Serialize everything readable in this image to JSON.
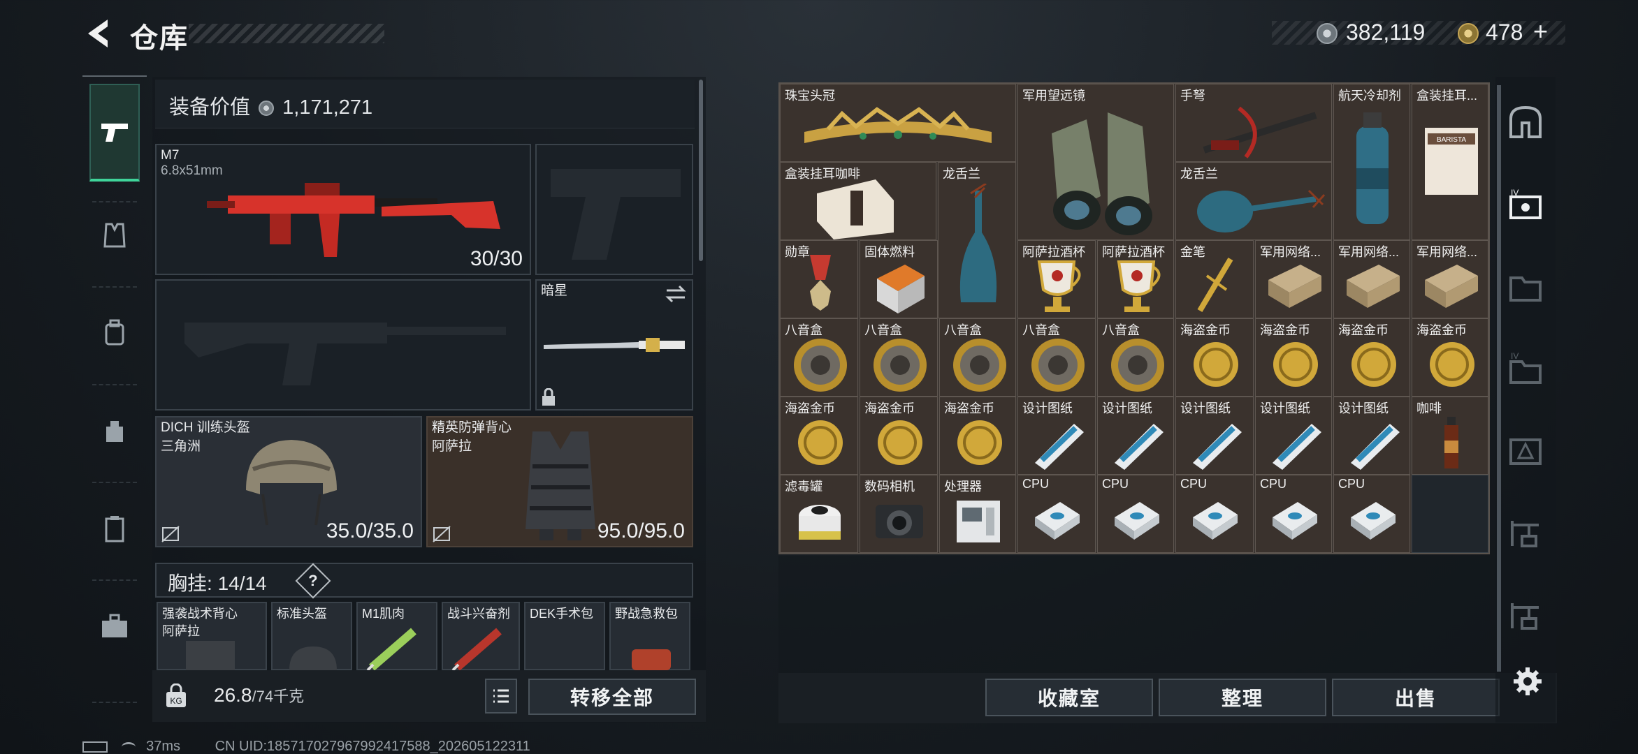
{
  "header": {
    "title": "仓库",
    "currency_silver": "382,119",
    "currency_gold": "478",
    "plus_label": "+"
  },
  "left_nav": {
    "items": [
      {
        "name": "weapons",
        "icon": "pistol-icon"
      },
      {
        "name": "armor",
        "icon": "vest-icon"
      },
      {
        "name": "backpack",
        "icon": "backpack-icon"
      },
      {
        "name": "bag",
        "icon": "bag-icon"
      },
      {
        "name": "clipboard",
        "icon": "clipboard-icon"
      },
      {
        "name": "toolbox",
        "icon": "toolbox-icon"
      }
    ]
  },
  "loadout": {
    "value_label": "装备价值",
    "value": "1,171,271",
    "primary": {
      "name": "M7",
      "ammo": "6.8x51mm",
      "count": "30/30"
    },
    "secondary_pistol": {
      "name": ""
    },
    "secondary_rifle": {
      "name": ""
    },
    "melee": {
      "name": "暗星"
    },
    "helmet": {
      "name": "DICH 训练头盔",
      "sub": "三角洲",
      "durability": "35.0/35.0"
    },
    "armor": {
      "name": "精英防弹背心",
      "sub": "阿萨拉",
      "durability": "95.0/95.0"
    },
    "chest_label": "胸挂:",
    "chest_count": "14/14",
    "chest_help": "?",
    "rig_items": [
      {
        "name": "强袭战术背心",
        "sub": "阿萨拉"
      },
      {
        "name": "标准头盔",
        "sub": ""
      },
      {
        "name": "M1肌肉",
        "sub": ""
      },
      {
        "name": "战斗兴奋剂",
        "sub": ""
      },
      {
        "name": "DEK手术包",
        "sub": ""
      },
      {
        "name": "野战急救包",
        "sub": ""
      }
    ],
    "weight": "26.8",
    "weight_max": "/74千克",
    "transfer_all": "转移全部"
  },
  "storage": {
    "items": [
      {
        "label": "珠宝头冠",
        "icon": "tiara-icon"
      },
      {
        "label": "军用望远镜",
        "icon": "binoculars-icon"
      },
      {
        "label": "手弩",
        "icon": "crossbow-icon"
      },
      {
        "label": "航天冷却剂",
        "icon": "coolant-icon"
      },
      {
        "label": "盒装挂耳...",
        "icon": "coffee-box-icon"
      },
      {
        "label": "盒装挂耳咖啡",
        "icon": "coffee-box-icon"
      },
      {
        "label": "龙舌兰",
        "icon": "bottle-icon"
      },
      {
        "label": "龙舌兰",
        "icon": "lamp-icon"
      },
      {
        "label": "勋章",
        "icon": "medal-icon"
      },
      {
        "label": "固体燃料",
        "icon": "fuel-icon"
      },
      {
        "label": "阿萨拉酒杯",
        "icon": "goblet-icon"
      },
      {
        "label": "阿萨拉酒杯",
        "icon": "goblet-icon"
      },
      {
        "label": "金笔",
        "icon": "pen-icon"
      },
      {
        "label": "军用网络...",
        "icon": "network-icon"
      },
      {
        "label": "军用网络...",
        "icon": "network-icon"
      },
      {
        "label": "军用网络...",
        "icon": "network-icon"
      },
      {
        "label": "八音盒",
        "icon": "music-box-icon"
      },
      {
        "label": "海盗金币",
        "icon": "gold-coin-icon"
      },
      {
        "label": "设计图纸",
        "icon": "blueprint-icon"
      },
      {
        "label": "咖啡",
        "icon": "coffee-bottle-icon"
      },
      {
        "label": "滤毒罐",
        "icon": "filter-icon"
      },
      {
        "label": "数码相机",
        "icon": "camera-icon"
      },
      {
        "label": "处理器",
        "icon": "processor-icon"
      },
      {
        "label": "CPU",
        "icon": "cpu-icon"
      }
    ]
  },
  "actions": {
    "collection": "收藏室",
    "sort": "整理",
    "sell": "出售"
  },
  "right_nav": {
    "items": [
      "vault-icon",
      "chest-iv-icon",
      "folder-icon",
      "folder-iv-icon",
      "warning-box-icon",
      "crane-icon",
      "crane-v-icon"
    ],
    "settings_icon": "gear-icon"
  },
  "status": {
    "ping": "37ms",
    "uid": "CN UID:1857170279679924175​88_202605122311"
  },
  "colors": {
    "accent": "#3fd49a",
    "cell_bg": "#3a322d",
    "gold": "#d1a83a"
  }
}
